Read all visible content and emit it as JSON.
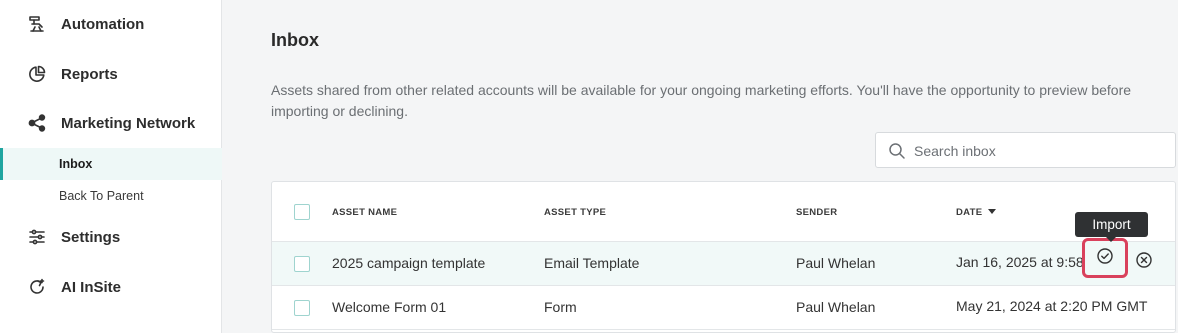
{
  "sidebar": {
    "items": [
      {
        "label": "Automation",
        "icon": "automation-icon"
      },
      {
        "label": "Reports",
        "icon": "reports-icon"
      },
      {
        "label": "Marketing Network",
        "icon": "share-network-icon"
      },
      {
        "label": "Settings",
        "icon": "settings-sliders-icon"
      },
      {
        "label": "AI InSite",
        "icon": "ai-insite-icon"
      }
    ],
    "subitems": [
      {
        "label": "Inbox",
        "active": true
      },
      {
        "label": "Back To Parent",
        "active": false
      }
    ]
  },
  "main": {
    "title": "Inbox",
    "description": "Assets shared from other related accounts will be available for your ongoing marketing efforts. You'll have the opportunity to preview before importing or declining.",
    "search": {
      "placeholder": "Search inbox",
      "value": ""
    }
  },
  "table": {
    "headers": {
      "asset_name": "ASSET NAME",
      "asset_type": "ASSET TYPE",
      "sender": "SENDER",
      "date": "DATE"
    },
    "rows": [
      {
        "asset_name": "2025 campaign template",
        "asset_type": "Email Template",
        "sender": "Paul Whelan",
        "date": "Jan 16, 2025 at 9:58 AM GMT"
      },
      {
        "asset_name": "Welcome Form 01",
        "asset_type": "Form",
        "sender": "Paul Whelan",
        "date": "May 21, 2024 at 2:20 PM GMT"
      }
    ]
  },
  "tooltip": {
    "label": "Import"
  },
  "colors": {
    "accent": "#1fa5a0",
    "highlight": "#d9415c",
    "active_bg": "#eef8f7",
    "tooltip_bg": "#2f3133"
  }
}
